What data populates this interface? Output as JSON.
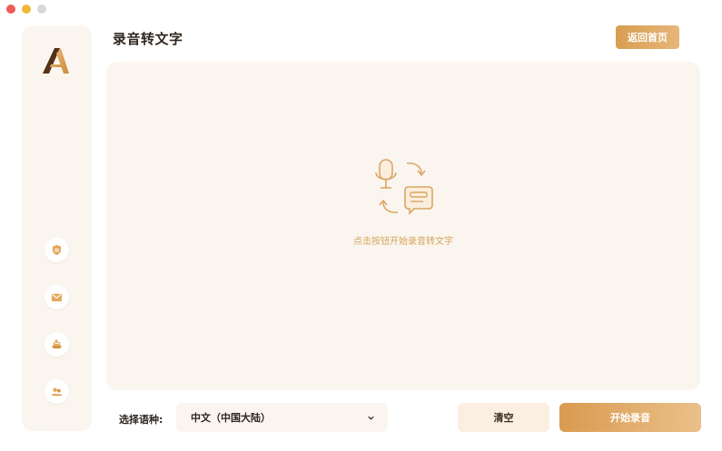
{
  "header": {
    "title": "录音转文字",
    "home_button_label": "返回首页"
  },
  "main": {
    "hint": "点击按钮开始录音转文字",
    "center_icon": "mic-to-text-icon"
  },
  "sidebar": {
    "logo": "app-logo",
    "items": [
      {
        "icon": "shield-icon"
      },
      {
        "icon": "mail-icon"
      },
      {
        "icon": "ship-icon"
      },
      {
        "icon": "users-icon"
      }
    ]
  },
  "footer": {
    "language_label": "选择语种:",
    "language_value": "中文（中国大陆）",
    "clear_label": "清空",
    "record_label": "开始录音"
  },
  "colors": {
    "accent": "#d99d52",
    "panel": "#faf6ef",
    "hint": "#d6a25c"
  }
}
